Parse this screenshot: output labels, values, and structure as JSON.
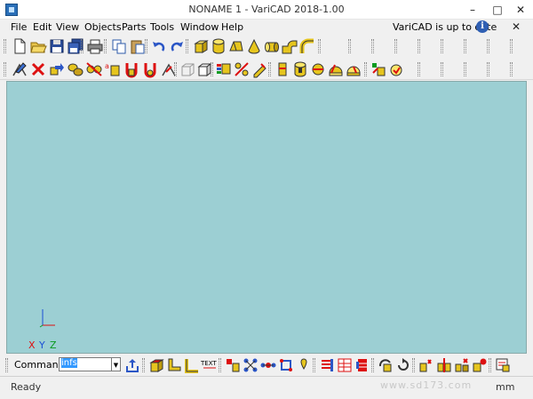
{
  "window": {
    "title": "NONAME 1 - VariCAD 2018-1.00",
    "minimize": "–",
    "maximize": "□",
    "close": "✕"
  },
  "menu": {
    "items": [
      {
        "label": "File",
        "icon": "none"
      },
      {
        "label": "Edit"
      },
      {
        "label": "View"
      },
      {
        "label": "Objects"
      },
      {
        "label": "Parts"
      },
      {
        "label": "Tools"
      },
      {
        "label": "Window"
      },
      {
        "label": "Help"
      }
    ],
    "update_status": "VariCAD is up to date",
    "info_glyph": "i",
    "close_glyph": "✕"
  },
  "toolbar1": {
    "buttons": [
      "new-file-icon",
      "open-file-icon",
      "save-icon",
      "save-all-icon",
      "print-icon",
      "copy-icon",
      "paste-icon",
      "undo-icon",
      "redo-icon",
      "box-solid-icon",
      "cylinder-solid-icon",
      "prism-solid-icon",
      "cone-solid-icon",
      "tube-solid-icon",
      "elbow-solid-icon",
      "pipe-bend-icon"
    ]
  },
  "toolbar2": {
    "buttons": [
      "sketch-icon",
      "delete-icon",
      "transform-icon",
      "copy-3d-icon",
      "assembly-icon",
      "attributes-icon",
      "measure-icon",
      "tools-icon",
      "wireframe-icon",
      "shaded-icon",
      "colors-icon",
      "hide-icon",
      "section-icon",
      "cut-cylinder-icon",
      "cut-box-icon",
      "subtract-icon",
      "union-icon",
      "intersect-icon",
      "analysis-icon"
    ]
  },
  "canvas": {
    "background": "#9ccfd3",
    "axes": {
      "x": "X",
      "y": "Y",
      "z": "Z"
    }
  },
  "command": {
    "label": "Command:",
    "value": "infs",
    "dropdown_glyph": "▼"
  },
  "command_toolbar": {
    "buttons": [
      "export-icon",
      "box-3d-icon",
      "angle-icon",
      "l-shape-icon",
      "text-icon",
      "insert-part-icon",
      "group-icon",
      "node-icon",
      "move-icon",
      "pin-icon",
      "list-icon",
      "bom-icon",
      "table-icon",
      "rotate-icon",
      "redo-view-icon",
      "mirror-icon",
      "align-icon",
      "explode-icon",
      "scale-icon",
      "properties-icon"
    ]
  },
  "status": {
    "text": "Ready",
    "unit": "mm",
    "watermark": "www.sd173.com"
  }
}
